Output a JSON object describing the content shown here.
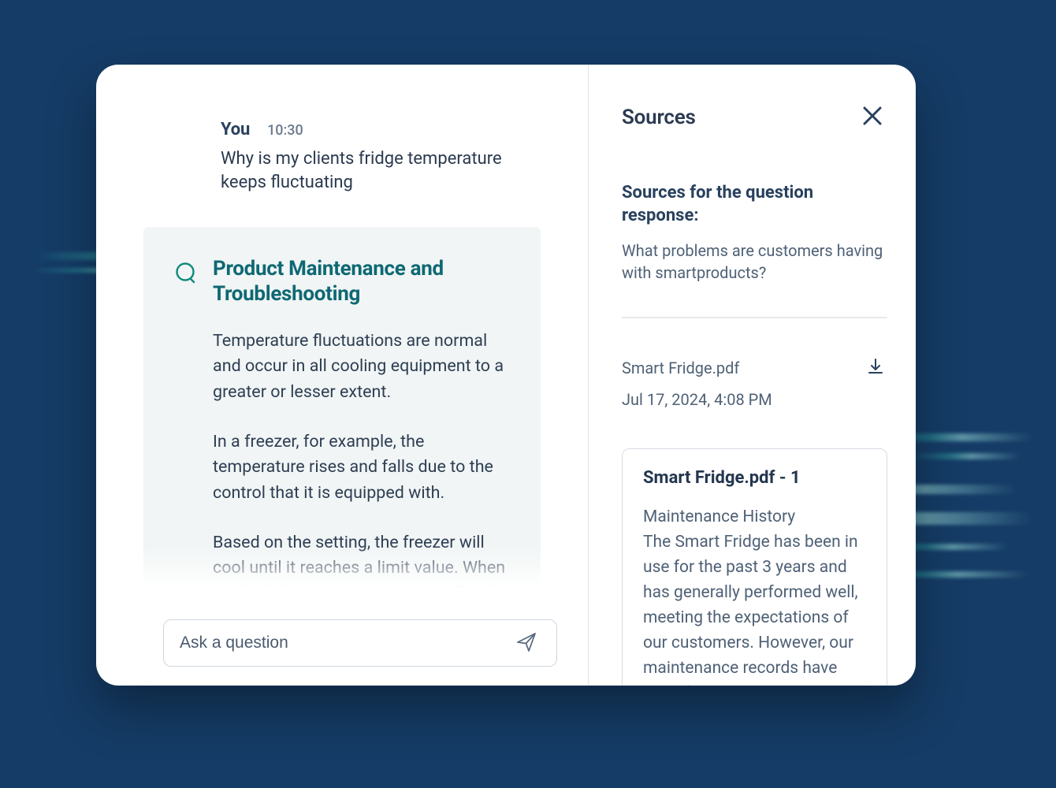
{
  "chat": {
    "user_label": "You",
    "user_time": "10:30",
    "user_message": "Why is my clients fridge temperature keeps fluctuating",
    "answer_title": "Product Maintenance and Troubleshooting",
    "answer_p1": "Temperature fluctuations are normal and occur in all cooling equipment to a greater or lesser extent.",
    "answer_p2": "In a freezer, for example, the temperature rises and falls due to the control that it is equipped with.",
    "answer_p3": "Based on the setting, the freezer will cool until it reaches a limit value. When reached the compressor turns off and the temperature rises",
    "input_placeholder": "Ask a question"
  },
  "sources": {
    "heading": "Sources",
    "subheading": "Sources for the question response:",
    "question": "What problems are customers having with smartproducts?",
    "file_name": "Smart Fridge.pdf",
    "file_date": "Jul 17, 2024, 4:08 PM",
    "card_title": "Smart Fridge.pdf - 1",
    "card_line1": "Maintenance History",
    "card_body": "The Smart Fridge has been in use for the past 3 years and has generally performed well, meeting the expectations of our customers. However, our maintenance records have identified two recurring issues that require attention:"
  }
}
